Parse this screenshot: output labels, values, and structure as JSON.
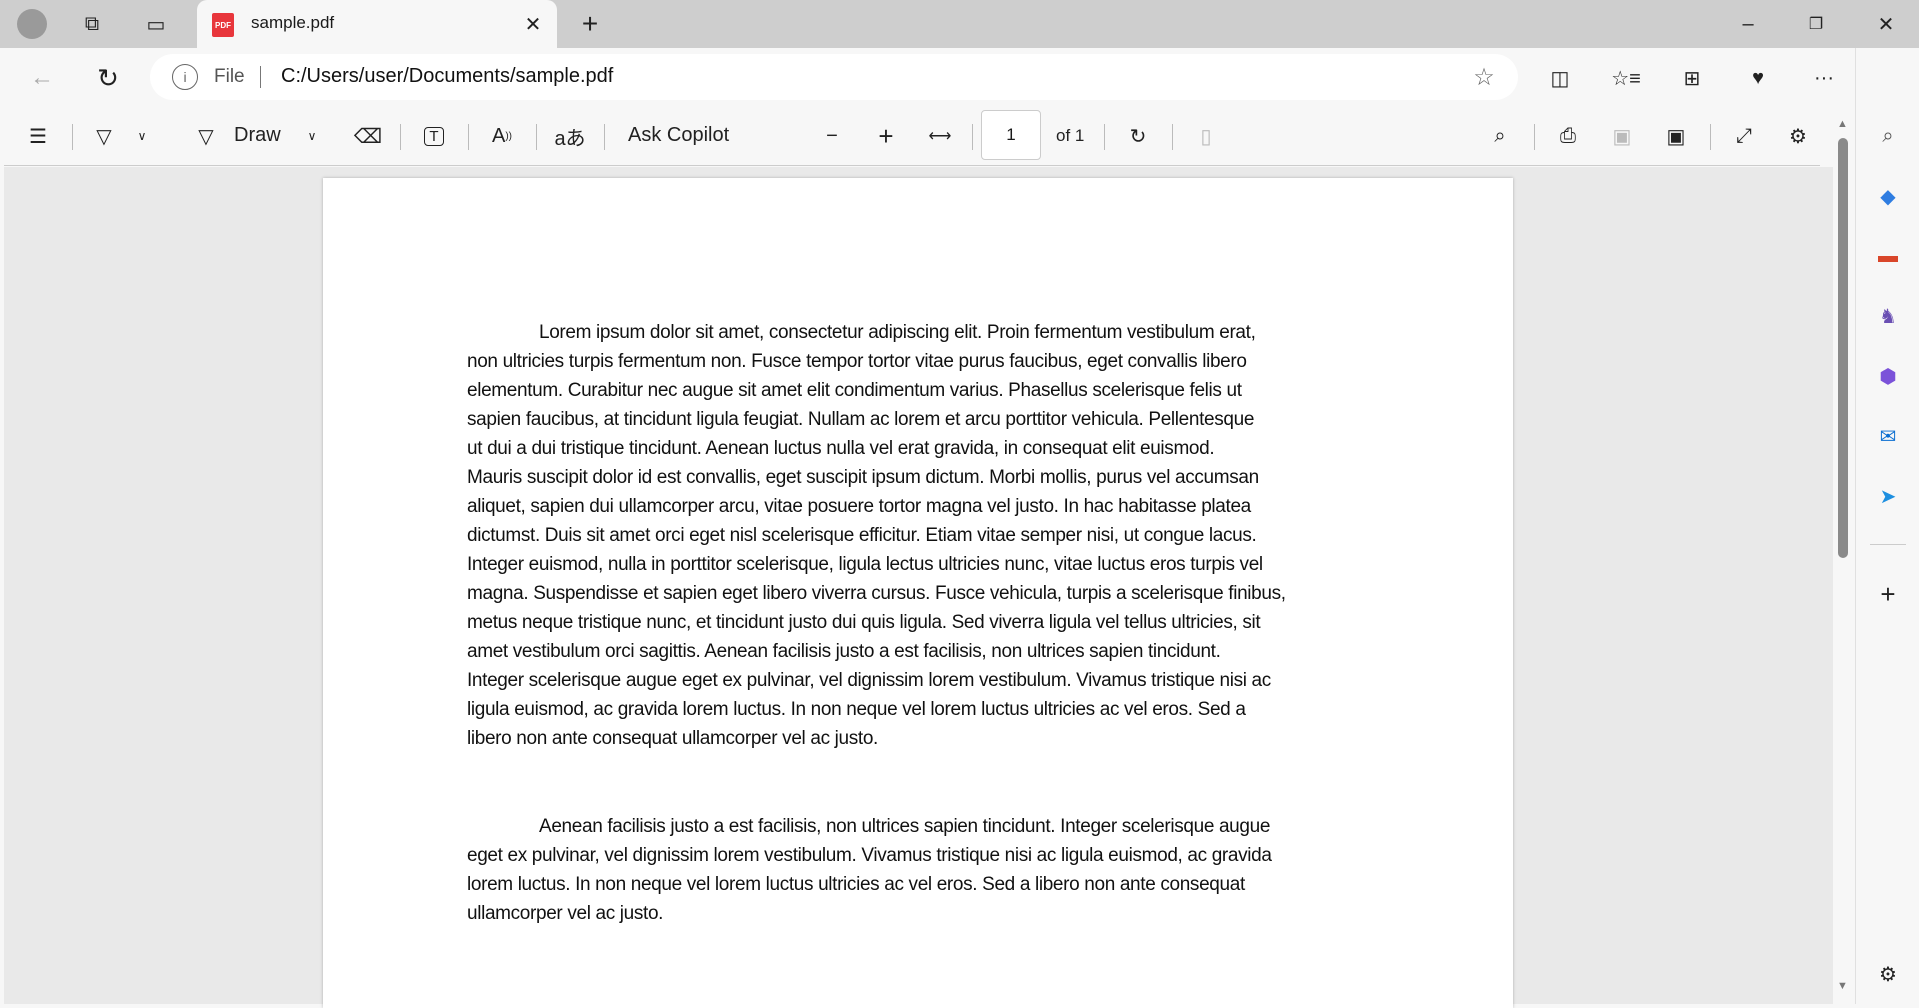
{
  "tab": {
    "title": "sample.pdf",
    "icon_label": "PDF"
  },
  "address": {
    "scheme": "File",
    "url": "C:/Users/user/Documents/sample.pdf"
  },
  "toolbar": {
    "draw_label": "Draw",
    "ask_copilot": "Ask Copilot",
    "page_number": "1",
    "page_total": "of 1"
  },
  "document": {
    "paragraphs": [
      [
        "Lorem ipsum dolor sit amet, consectetur adipiscing elit. Proin fermentum vestibulum erat,",
        "non ultricies turpis fermentum non. Fusce tempor tortor vitae purus faucibus, eget convallis libero",
        "elementum. Curabitur nec augue sit amet elit condimentum varius. Phasellus scelerisque felis ut",
        "sapien faucibus, at tincidunt ligula feugiat. Nullam ac lorem et arcu porttitor vehicula. Pellentesque",
        "ut dui a dui tristique tincidunt. Aenean luctus nulla vel erat gravida, in consequat elit euismod.",
        "Mauris suscipit dolor id est convallis, eget suscipit ipsum dictum. Morbi mollis, purus vel accumsan",
        "aliquet, sapien dui ullamcorper arcu, vitae posuere tortor magna vel justo. In hac habitasse platea",
        "dictumst. Duis sit amet orci eget nisl scelerisque efficitur. Etiam vitae semper nisi, ut congue lacus.",
        "Integer euismod, nulla in porttitor scelerisque, ligula lectus ultricies nunc, vitae luctus eros turpis vel",
        "magna. Suspendisse et sapien eget libero viverra cursus. Fusce vehicula, turpis a scelerisque finibus,",
        "metus neque tristique nunc, et tincidunt justo dui quis ligula. Sed viverra ligula vel tellus ultricies, sit",
        "amet vestibulum orci sagittis. Aenean facilisis justo a est facilisis, non ultrices sapien tincidunt.",
        "Integer scelerisque augue eget ex pulvinar, vel dignissim lorem vestibulum. Vivamus tristique nisi ac",
        "ligula euismod, ac gravida lorem luctus. In non neque vel lorem luctus ultricies ac vel eros. Sed a",
        "libero non ante consequat ullamcorper vel ac justo."
      ],
      [
        "Aenean facilisis justo a est facilisis, non ultrices sapien tincidunt. Integer scelerisque augue",
        "eget ex pulvinar, vel dignissim lorem vestibulum. Vivamus tristique nisi ac ligula euismod, ac gravida",
        "lorem luctus. In non neque vel lorem luctus ultricies ac vel eros. Sed a libero non ante consequat",
        "ullamcorper vel ac justo."
      ]
    ]
  },
  "colors": {
    "pdf_icon": "#e8363c",
    "copilot": "#1b8ee8"
  }
}
